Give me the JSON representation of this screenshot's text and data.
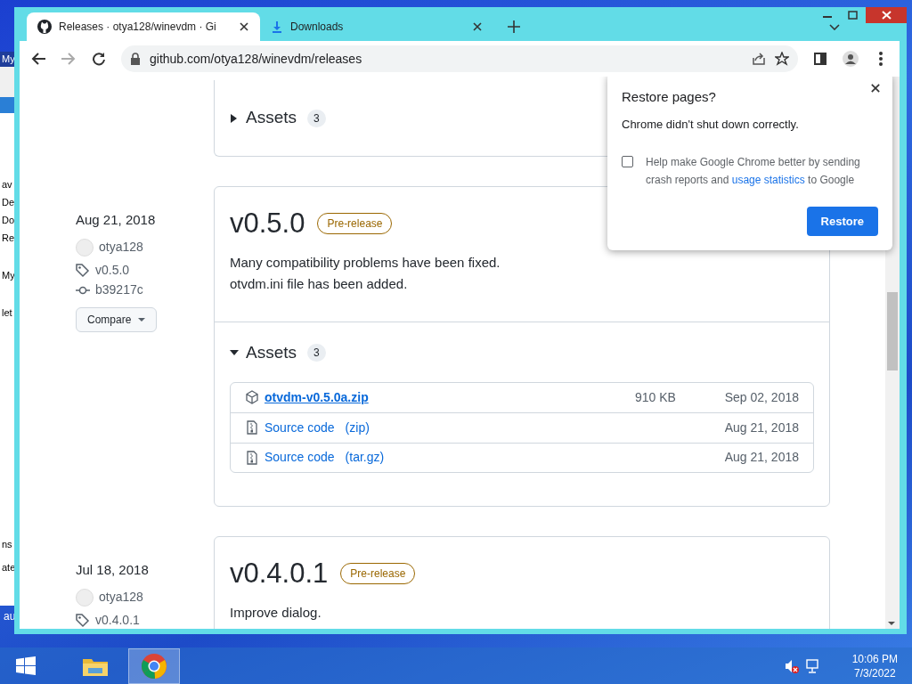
{
  "behind_window": {
    "texts": [
      "My",
      "av",
      "De",
      "Do",
      "Re",
      "My",
      "let",
      "ns",
      "ate"
    ]
  },
  "desktop_text": "au",
  "browser": {
    "tabs": [
      {
        "title": "Releases · otya128/winevdm · Gi",
        "kind": "github",
        "selected": true
      },
      {
        "title": "Downloads",
        "kind": "download",
        "selected": false
      }
    ],
    "address": "github.com/otya128/winevdm/releases"
  },
  "releases": [
    {
      "partial": true,
      "assets": {
        "label": "Assets",
        "count": "3",
        "expanded": false
      }
    },
    {
      "partial": false,
      "date": "Aug 21, 2018",
      "author": "otya128",
      "tag": "v0.5.0",
      "commit": "b39217c",
      "compare": "Compare",
      "title": "v0.5.0",
      "badge": "Pre-release",
      "notes": [
        "Many compatibility problems have been fixed.",
        "otvdm.ini file has been added."
      ],
      "assets": {
        "label": "Assets",
        "count": "3",
        "expanded": true,
        "files": [
          {
            "kind": "package",
            "name": "otvdm-v0.5.0a.zip",
            "size": "910 KB",
            "date": "Sep 02, 2018"
          },
          {
            "kind": "source",
            "name": "Source code",
            "format": "(zip)",
            "date": "Aug 21, 2018"
          },
          {
            "kind": "source",
            "name": "Source code",
            "format": "(tar.gz)",
            "date": "Aug 21, 2018"
          }
        ]
      }
    },
    {
      "partial": false,
      "date": "Jul 18, 2018",
      "author": "otya128",
      "tag": "v0.4.0.1",
      "title": "v0.4.0.1",
      "badge": "Pre-release",
      "notes": [
        "Improve dialog."
      ]
    }
  ],
  "dialog": {
    "title": "Restore pages?",
    "message": "Chrome didn't shut down correctly.",
    "checkbox": {
      "text_before": "Help make Google Chrome better by sending crash reports and",
      "link": "usage statistics",
      "text_after": "to Google",
      "checked": false
    },
    "button": "Restore"
  },
  "taskbar": {
    "volume_muted": true,
    "time": "10:06 PM",
    "date": "7/3/2022"
  }
}
